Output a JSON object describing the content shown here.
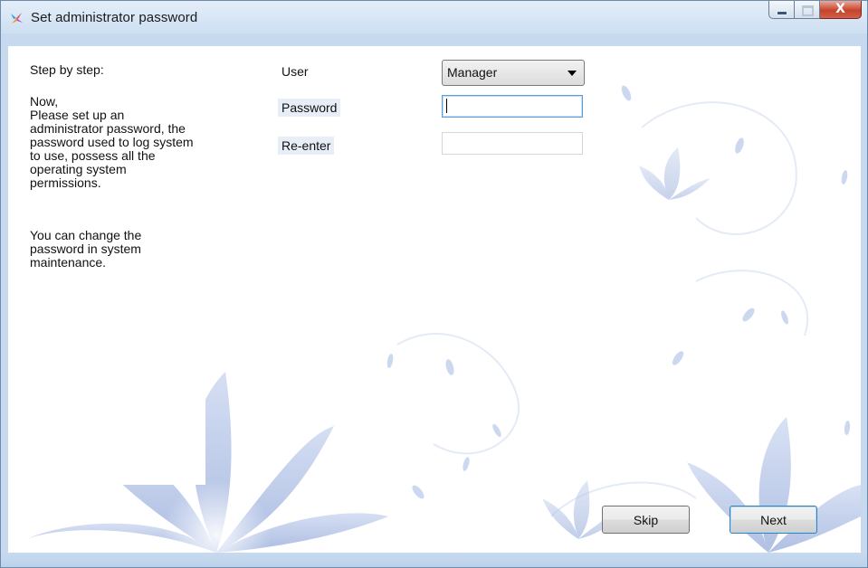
{
  "window": {
    "title": "Set administrator password",
    "icon": "app-flower-icon",
    "caption": {
      "minimize": "minimize-icon",
      "maximize": "maximize-icon",
      "close": "close-icon",
      "close_glyph": "X"
    }
  },
  "info": {
    "heading": "Step by step:",
    "paragraph1": "Now,\nPlease set up an\nadministrator password, the\npassword used to log system\nto use, possess all the\noperating system\npermissions.",
    "paragraph2": "You can change the\npassword in system\nmaintenance."
  },
  "form": {
    "user_label": "User",
    "user_value": "Manager",
    "password_label": "Password",
    "password_value": "",
    "reenter_label": "Re-enter",
    "reenter_value": ""
  },
  "buttons": {
    "skip": "Skip",
    "next": "Next"
  },
  "colors": {
    "accent": "#5a9cdc",
    "petal": "#b9c9ea",
    "chrome": "#c6d9ee"
  }
}
